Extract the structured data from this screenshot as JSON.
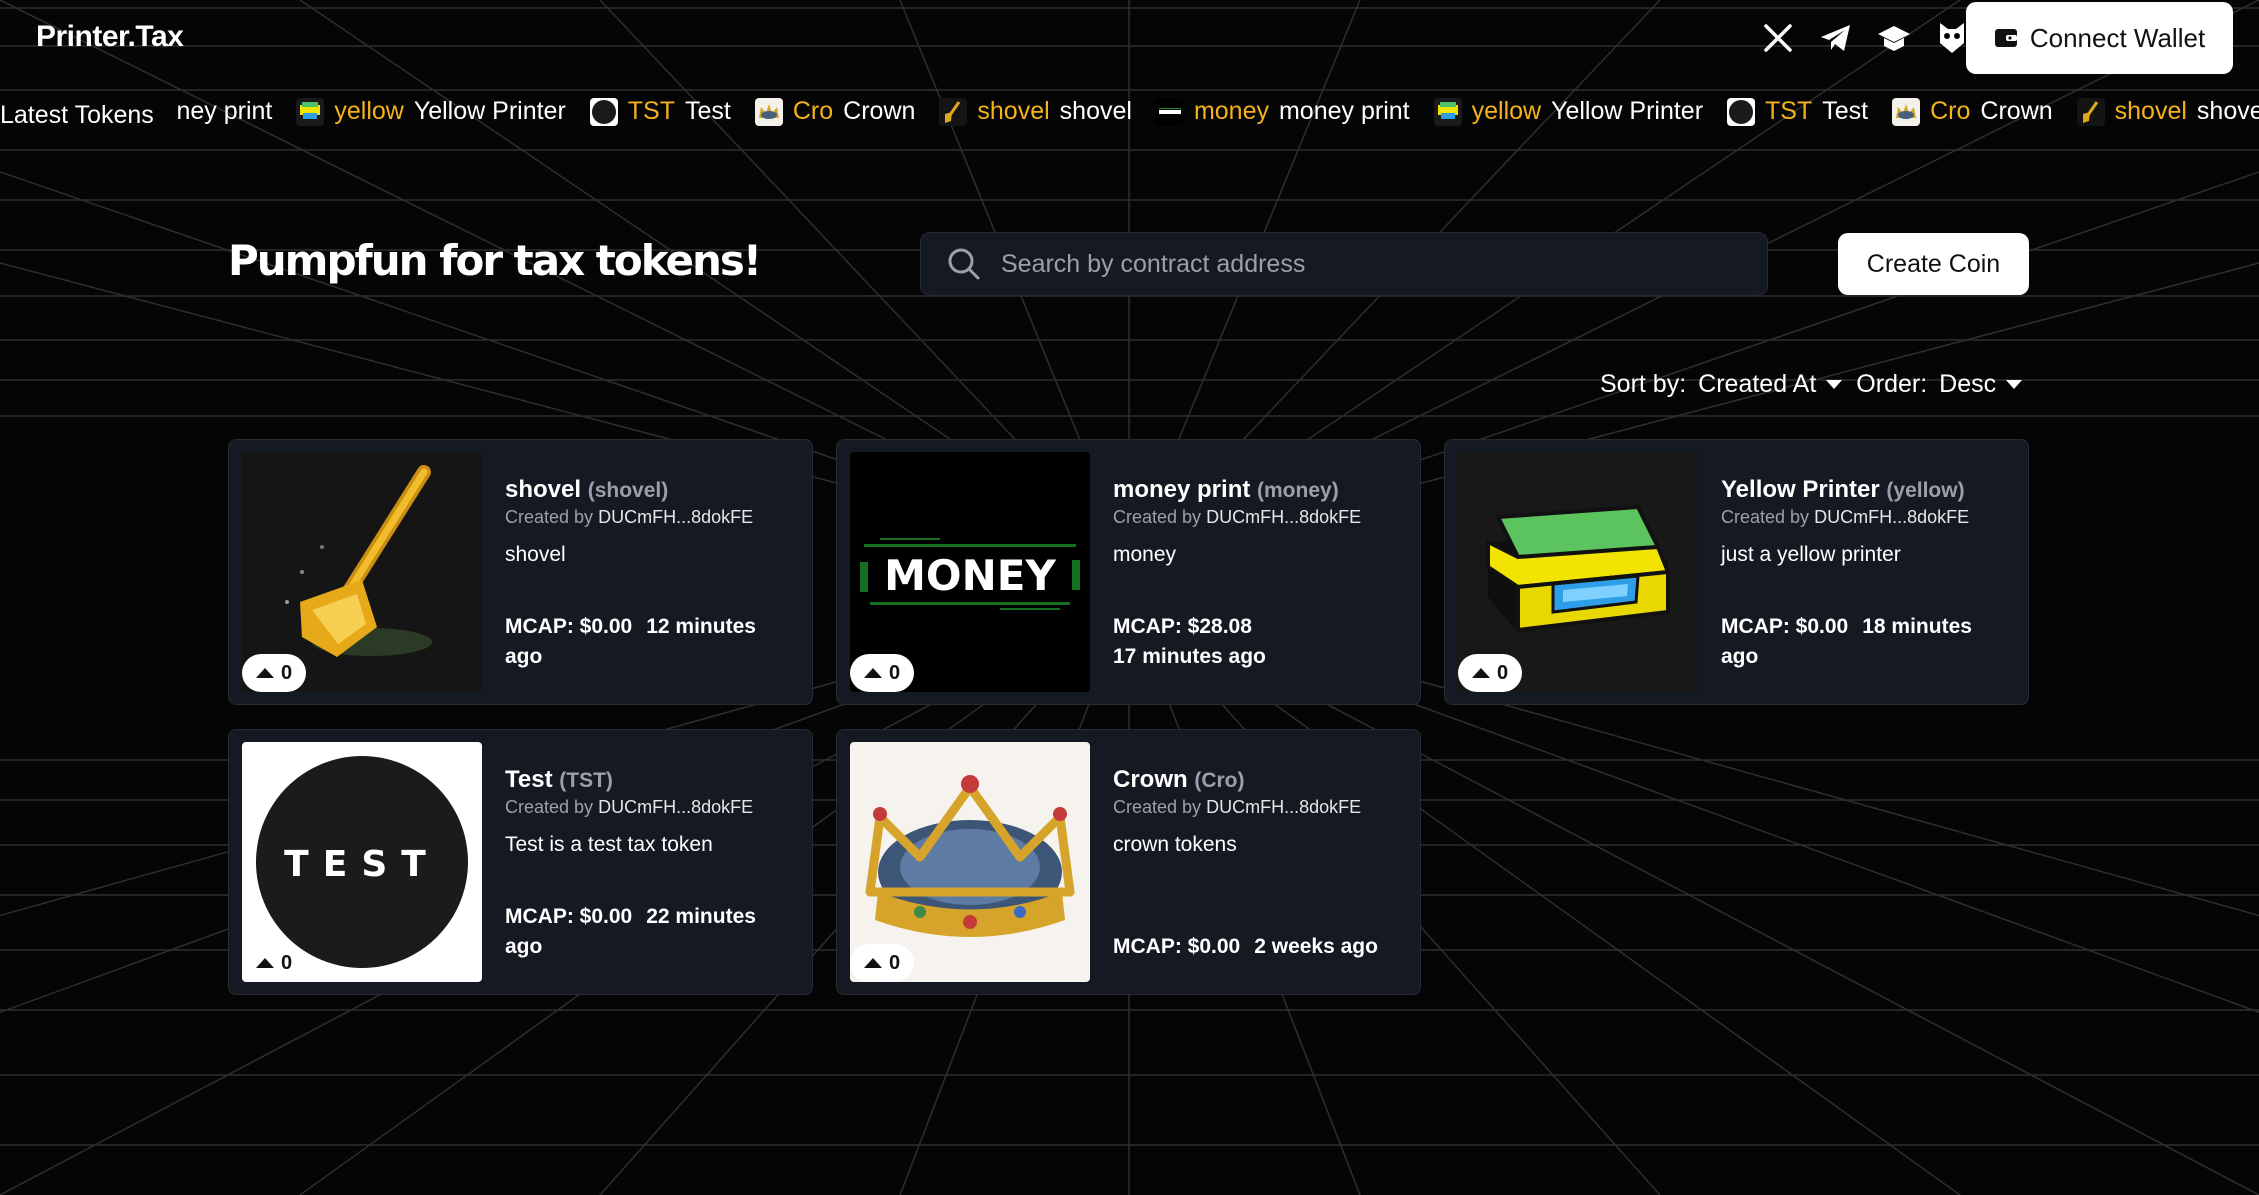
{
  "header": {
    "brand": "Printer.Tax",
    "socials": [
      {
        "icon": "x-icon"
      },
      {
        "icon": "telegram-icon"
      },
      {
        "icon": "docs-icon"
      },
      {
        "icon": "owl-icon"
      }
    ],
    "connect_label": "Connect Wallet"
  },
  "ticker": {
    "label": "Latest Tokens",
    "items": [
      {
        "symbol": "",
        "name": "ioney print"
      },
      {
        "symbol": "yellow",
        "name": "Yellow Printer"
      },
      {
        "symbol": "TST",
        "name": "Test"
      },
      {
        "symbol": "Cro",
        "name": "Crown"
      },
      {
        "symbol": "shovel",
        "name": "shovel"
      },
      {
        "symbol": "money",
        "name": "money print"
      },
      {
        "symbol": "yellow",
        "name": "Yellow Printer"
      },
      {
        "symbol": "TST",
        "name": "Test"
      },
      {
        "symbol": "Cro",
        "name": "Crown"
      },
      {
        "symbol": "shovel",
        "name": "shovel"
      }
    ]
  },
  "hero": {
    "title": "Pumpfun for tax tokens!",
    "search_placeholder": "Search by contract address",
    "create_label": "Create Coin"
  },
  "sort": {
    "sort_label": "Sort by:",
    "sort_value": "Created At",
    "order_label": "Order:",
    "order_value": "Desc"
  },
  "cards": [
    {
      "name": "shovel",
      "symbol": "(shovel)",
      "created_prefix": "Created by",
      "creator": "DUCmFH...8dokFE",
      "description": "shovel",
      "mcap": "MCAP: $0.00",
      "age": "12 minutes ago",
      "votes": "0",
      "image": "shovel"
    },
    {
      "name": "money print",
      "symbol": "(money)",
      "created_prefix": "Created by",
      "creator": "DUCmFH...8dokFE",
      "description": "money",
      "mcap": "MCAP: $28.08",
      "age": "17 minutes ago",
      "votes": "0",
      "image": "money",
      "image_text": "MONEY"
    },
    {
      "name": "Yellow Printer",
      "symbol": "(yellow)",
      "created_prefix": "Created by",
      "creator": "DUCmFH...8dokFE",
      "description": "just a yellow printer",
      "mcap": "MCAP: $0.00",
      "age": "18 minutes ago",
      "votes": "0",
      "image": "printer"
    },
    {
      "name": "Test",
      "symbol": "(TST)",
      "created_prefix": "Created by",
      "creator": "DUCmFH...8dokFE",
      "description": "Test is a test tax token",
      "mcap": "MCAP: $0.00",
      "age": "22 minutes ago",
      "votes": "0",
      "image": "test",
      "image_text": "TEST"
    },
    {
      "name": "Crown",
      "symbol": "(Cro)",
      "created_prefix": "Created by",
      "creator": "DUCmFH...8dokFE",
      "description": "crown tokens",
      "mcap": "MCAP: $0.00",
      "age": "2 weeks ago",
      "votes": "0",
      "image": "crown"
    }
  ],
  "colors": {
    "background": "#050505",
    "card": "#151922",
    "card_border": "#262b36",
    "accent": "#f5b21a",
    "muted": "#9aa0ab"
  }
}
